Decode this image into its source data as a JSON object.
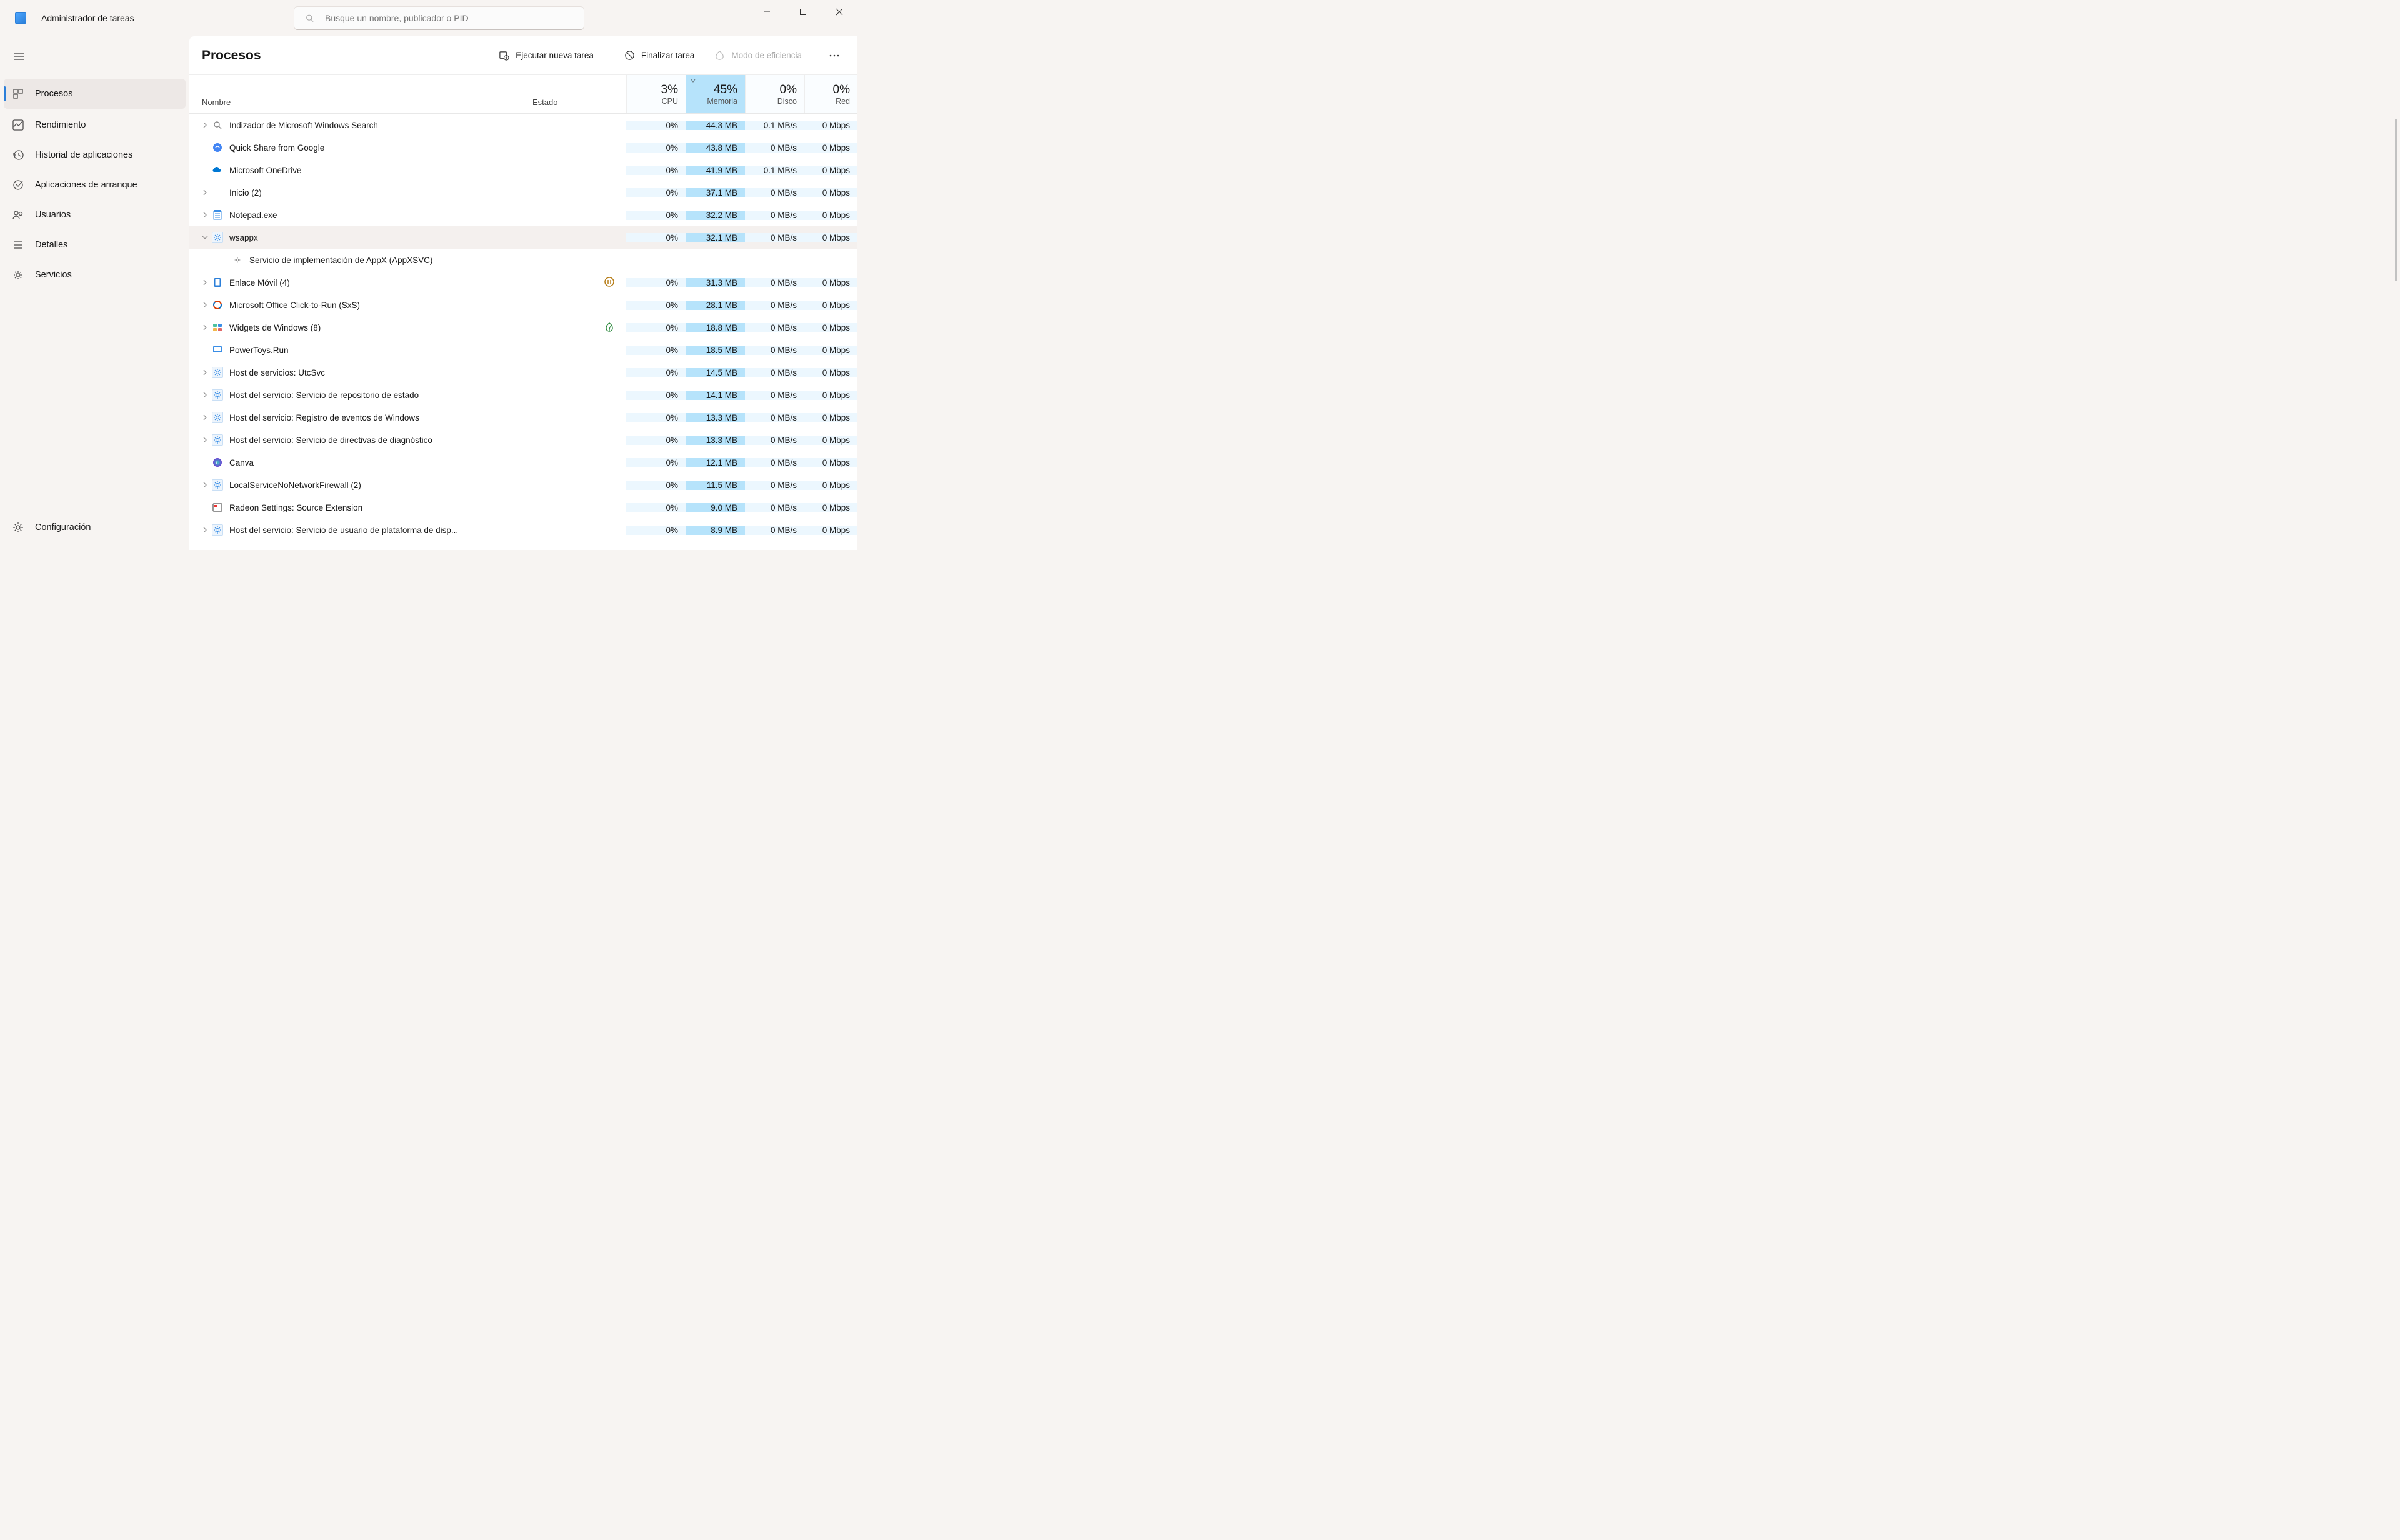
{
  "app": {
    "title": "Administrador de tareas"
  },
  "search": {
    "placeholder": "Busque un nombre, publicador o PID"
  },
  "sidebar": {
    "items": [
      {
        "label": "Procesos",
        "active": true
      },
      {
        "label": "Rendimiento"
      },
      {
        "label": "Historial de aplicaciones"
      },
      {
        "label": "Aplicaciones de arranque"
      },
      {
        "label": "Usuarios"
      },
      {
        "label": "Detalles"
      },
      {
        "label": "Servicios"
      }
    ],
    "settings_label": "Configuración"
  },
  "page": {
    "title": "Procesos",
    "toolbar": {
      "run_new_task": "Ejecutar nueva tarea",
      "end_task": "Finalizar tarea",
      "efficiency_mode": "Modo de eficiencia"
    },
    "columns": {
      "name": "Nombre",
      "status": "Estado",
      "cpu": {
        "pct": "3%",
        "label": "CPU"
      },
      "memory": {
        "pct": "45%",
        "label": "Memoria"
      },
      "disk": {
        "pct": "0%",
        "label": "Disco"
      },
      "network": {
        "pct": "0%",
        "label": "Red"
      }
    }
  },
  "processes": [
    {
      "expand": "right",
      "icon": "search-index",
      "name": "Indizador de Microsoft Windows Search",
      "cpu": "0%",
      "mem": "44.3 MB",
      "disk": "0.1 MB/s",
      "net": "0 Mbps"
    },
    {
      "expand": "none",
      "icon": "quickshare",
      "name": "Quick Share from Google",
      "cpu": "0%",
      "mem": "43.8 MB",
      "disk": "0 MB/s",
      "net": "0 Mbps"
    },
    {
      "expand": "none",
      "icon": "onedrive",
      "name": "Microsoft OneDrive",
      "cpu": "0%",
      "mem": "41.9 MB",
      "disk": "0.1 MB/s",
      "net": "0 Mbps"
    },
    {
      "expand": "right",
      "icon": "blank",
      "name": "Inicio (2)",
      "cpu": "0%",
      "mem": "37.1 MB",
      "disk": "0 MB/s",
      "net": "0 Mbps"
    },
    {
      "expand": "right",
      "icon": "notepad",
      "name": "Notepad.exe",
      "cpu": "0%",
      "mem": "32.2 MB",
      "disk": "0 MB/s",
      "net": "0 Mbps"
    },
    {
      "expand": "down",
      "icon": "gear",
      "name": "wsappx",
      "cpu": "0%",
      "mem": "32.1 MB",
      "disk": "0 MB/s",
      "net": "0 Mbps",
      "selected": true
    },
    {
      "child": true,
      "icon": "gear-small",
      "name": "Servicio de implementación de AppX (AppXSVC)"
    },
    {
      "expand": "right",
      "icon": "phone",
      "name": "Enlace Móvil (4)",
      "status": "pause",
      "cpu": "0%",
      "mem": "31.3 MB",
      "disk": "0 MB/s",
      "net": "0 Mbps"
    },
    {
      "expand": "right",
      "icon": "office",
      "name": "Microsoft Office Click-to-Run (SxS)",
      "cpu": "0%",
      "mem": "28.1 MB",
      "disk": "0 MB/s",
      "net": "0 Mbps"
    },
    {
      "expand": "right",
      "icon": "widgets",
      "name": "Widgets de Windows (8)",
      "status": "leaf",
      "cpu": "0%",
      "mem": "18.8 MB",
      "disk": "0 MB/s",
      "net": "0 Mbps"
    },
    {
      "expand": "none",
      "icon": "powertoys",
      "name": "PowerToys.Run",
      "cpu": "0%",
      "mem": "18.5 MB",
      "disk": "0 MB/s",
      "net": "0 Mbps"
    },
    {
      "expand": "right",
      "icon": "gear",
      "name": "Host de servicios: UtcSvc",
      "cpu": "0%",
      "mem": "14.5 MB",
      "disk": "0 MB/s",
      "net": "0 Mbps"
    },
    {
      "expand": "right",
      "icon": "gear",
      "name": "Host del servicio: Servicio de repositorio de estado",
      "cpu": "0%",
      "mem": "14.1 MB",
      "disk": "0 MB/s",
      "net": "0 Mbps"
    },
    {
      "expand": "right",
      "icon": "gear",
      "name": "Host del servicio: Registro de eventos de Windows",
      "cpu": "0%",
      "mem": "13.3 MB",
      "disk": "0 MB/s",
      "net": "0 Mbps"
    },
    {
      "expand": "right",
      "icon": "gear",
      "name": "Host del servicio: Servicio de directivas de diagnóstico",
      "cpu": "0%",
      "mem": "13.3 MB",
      "disk": "0 MB/s",
      "net": "0 Mbps"
    },
    {
      "expand": "none",
      "icon": "canva",
      "name": "Canva",
      "cpu": "0%",
      "mem": "12.1 MB",
      "disk": "0 MB/s",
      "net": "0 Mbps"
    },
    {
      "expand": "right",
      "icon": "gear",
      "name": "LocalServiceNoNetworkFirewall (2)",
      "cpu": "0%",
      "mem": "11.5 MB",
      "disk": "0 MB/s",
      "net": "0 Mbps"
    },
    {
      "expand": "none",
      "icon": "radeon",
      "name": "Radeon Settings: Source Extension",
      "cpu": "0%",
      "mem": "9.0 MB",
      "disk": "0 MB/s",
      "net": "0 Mbps"
    },
    {
      "expand": "right",
      "icon": "gear",
      "name": "Host del servicio: Servicio de usuario de plataforma de disp...",
      "cpu": "0%",
      "mem": "8.9 MB",
      "disk": "0 MB/s",
      "net": "0 Mbps"
    }
  ]
}
